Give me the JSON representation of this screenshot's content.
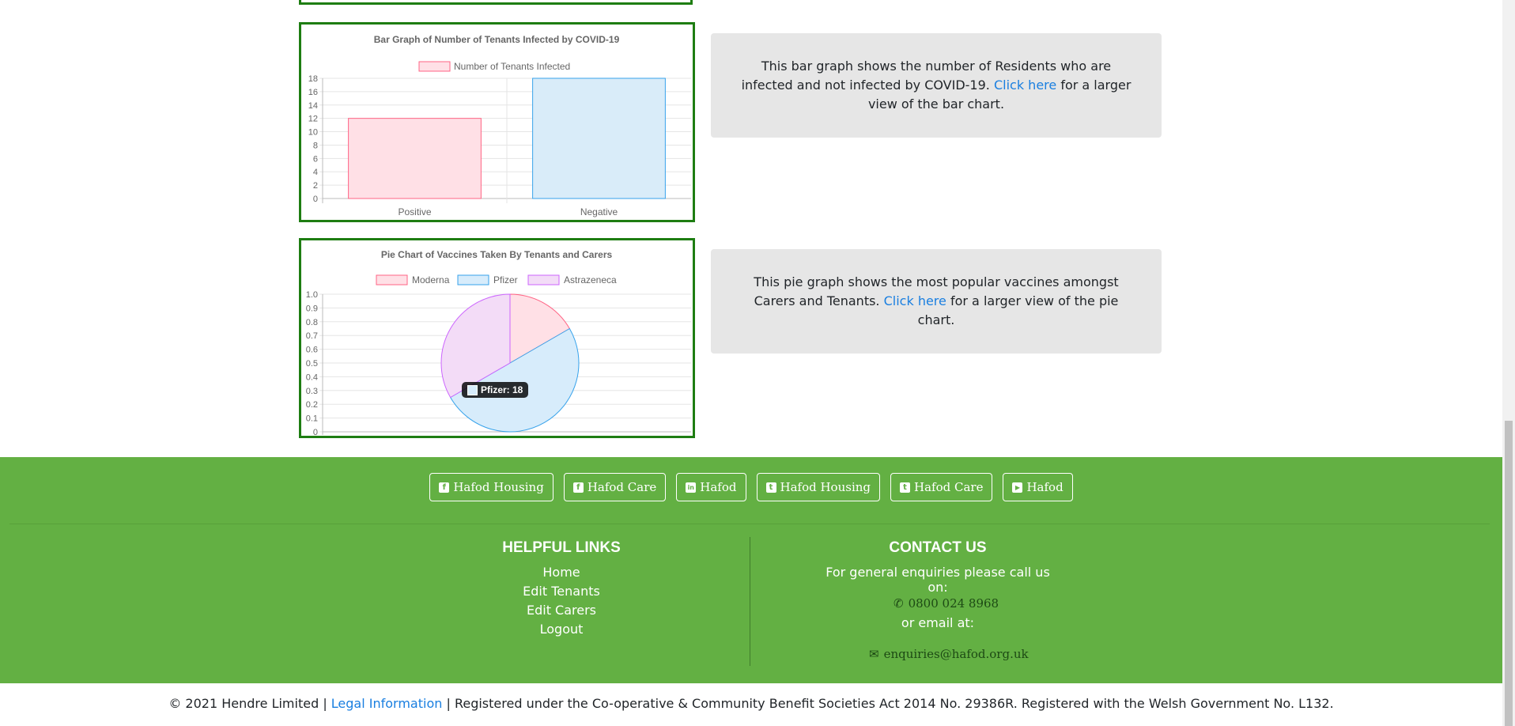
{
  "bar_section": {
    "description_before": "This bar graph shows the number of Residents who are infected and not infected by COVID-19.",
    "link_text": "Click here",
    "description_after": "for a larger view of the bar chart."
  },
  "pie_section": {
    "description_before": "This pie graph shows the most popular vaccines amongst Carers and Tenants.",
    "link_text": "Click here",
    "description_after": "for a larger view of the pie chart.",
    "tooltip": "Pfizer: 18"
  },
  "chart_data": [
    {
      "type": "bar",
      "title": "Bar Graph of Number of Tenants Infected by COVID-19",
      "categories": [
        "Positive",
        "Negative"
      ],
      "series": [
        {
          "name": "Number of Tenants Infected",
          "values": [
            12,
            18
          ]
        }
      ],
      "ylim": [
        0,
        18
      ],
      "yticks": [
        0,
        2,
        4,
        6,
        8,
        10,
        12,
        14,
        16,
        18
      ],
      "colors": {
        "fill": [
          "#ffe0e6",
          "#d9ecf9"
        ],
        "stroke": [
          "#ff6384",
          "#36a2eb"
        ]
      },
      "legend": "top",
      "grid": true
    },
    {
      "type": "pie",
      "title": "Pie Chart of Vaccines Taken By Tenants and Carers",
      "labels": [
        "Moderna",
        "Pfizer",
        "Astrazeneca"
      ],
      "values": [
        6,
        18,
        12
      ],
      "yticks": [
        "0",
        "0.1",
        "0.2",
        "0.3",
        "0.4",
        "0.5",
        "0.6",
        "0.7",
        "0.8",
        "0.9",
        "1.0"
      ],
      "colors": {
        "fill": [
          "#ffe0e6",
          "#d7ecfb",
          "#f3dcf7"
        ],
        "stroke": [
          "#ff6384",
          "#36a2eb",
          "#cc65fe"
        ]
      },
      "legend": "top",
      "grid": true
    }
  ],
  "footer": {
    "social": [
      {
        "icon": "facebook-icon",
        "glyph": "f",
        "label": "Hafod Housing"
      },
      {
        "icon": "facebook-icon",
        "glyph": "f",
        "label": "Hafod Care"
      },
      {
        "icon": "linkedin-icon",
        "glyph": "in",
        "label": "Hafod"
      },
      {
        "icon": "twitter-icon",
        "glyph": "t",
        "label": "Hafod Housing"
      },
      {
        "icon": "twitter-icon",
        "glyph": "t",
        "label": "Hafod Care"
      },
      {
        "icon": "youtube-icon",
        "glyph": "▶",
        "label": "Hafod"
      }
    ],
    "helpful_links_title": "HELPFUL LINKS",
    "links": [
      "Home",
      "Edit Tenants",
      "Edit Carers",
      "Logout"
    ],
    "contact_title": "CONTACT US",
    "contact_intro": "For general enquiries please call us on:",
    "phone": "0800 024 8968",
    "or_email": "or email at:",
    "email": "enquiries@hafod.org.uk"
  },
  "copyright": {
    "before": "© 2021 Hendre Limited |",
    "link": "Legal Information",
    "after": "| Registered under the Co-operative & Community Benefit Societies Act 2014 No. 29386R. Registered with the Welsh Government No. L132."
  },
  "colors": {
    "footer_green": "#63b043",
    "card_border": "#1e7d12",
    "link_blue": "#1a7fe0"
  }
}
